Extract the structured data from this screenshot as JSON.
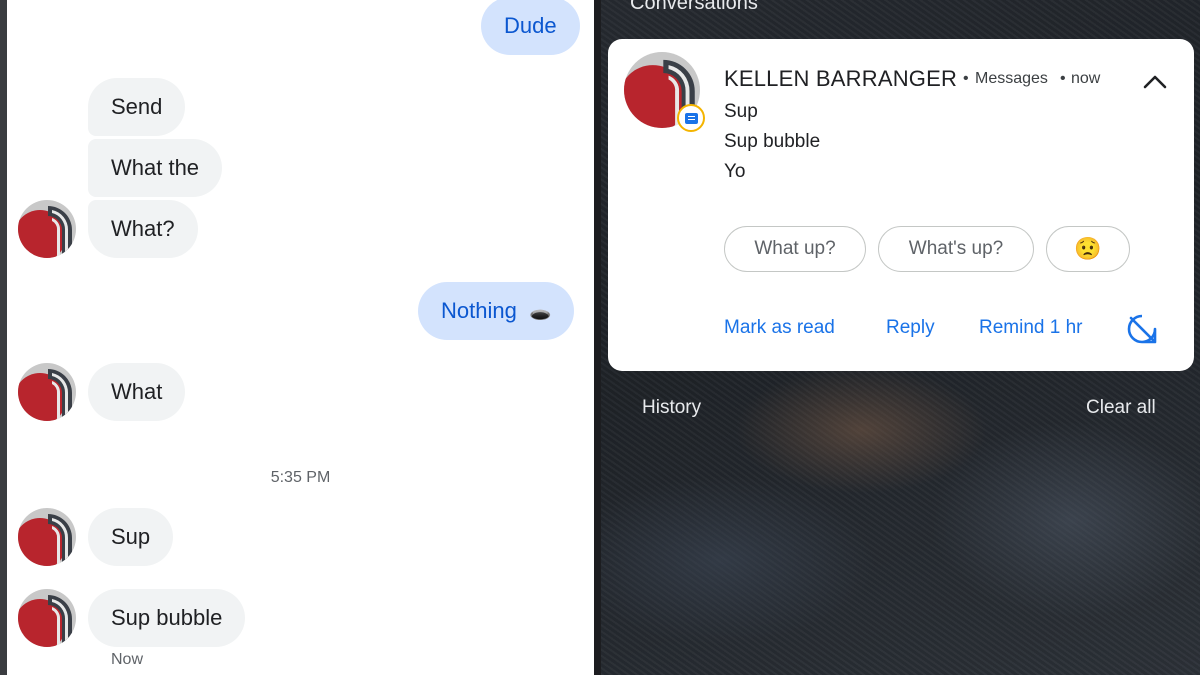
{
  "chat": {
    "messages_outgoing": [
      {
        "text": "Dude"
      },
      {
        "text": "Nothing",
        "emoji": "🕳️"
      }
    ],
    "messages_incoming": [
      {
        "text": "Send"
      },
      {
        "text": "What the"
      },
      {
        "text": "What?"
      },
      {
        "text": "What"
      },
      {
        "text": "Sup"
      },
      {
        "text": "Sup bubble"
      }
    ],
    "timestamp": "5:35 PM",
    "last_status": "Now"
  },
  "shade": {
    "section_title": "Conversations",
    "notification": {
      "sender": "KELLEN BARRANGER",
      "app": "Messages",
      "time": "now",
      "separator": "•",
      "lines": [
        "Sup",
        "Sup bubble",
        "Yo"
      ],
      "smart_replies": [
        "What up?",
        "What's up?",
        "😟"
      ],
      "actions": [
        "Mark as read",
        "Reply",
        "Remind 1 hr"
      ],
      "app_badge_color": "#f4b400",
      "accent_color": "#1a73e8"
    },
    "history_label": "History",
    "clear_all_label": "Clear all"
  },
  "icons": {
    "collapse": "chevron-up-icon",
    "snooze": "bubble-off-icon",
    "app_badge": "messages-app-icon"
  }
}
